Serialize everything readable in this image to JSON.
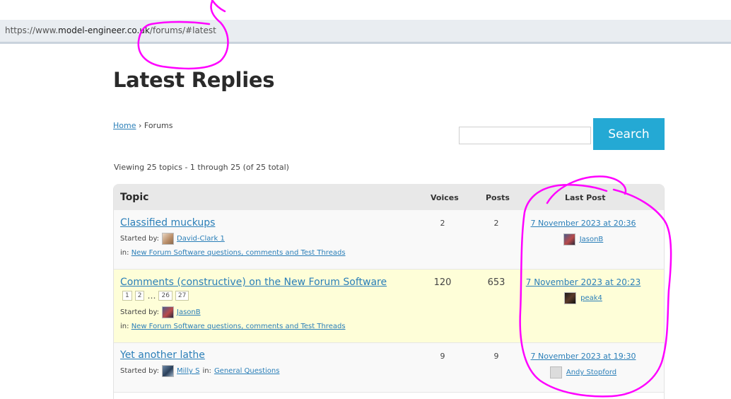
{
  "browser": {
    "url_prefix": "https://www.",
    "url_domain": "model-engineer.co.uk",
    "url_path": "/forums/#latest"
  },
  "page": {
    "title": "Latest Replies"
  },
  "breadcrumb": {
    "home": "Home",
    "separator": "›",
    "current": "Forums"
  },
  "search": {
    "button_label": "Search",
    "placeholder": ""
  },
  "viewing": "Viewing 25 topics - 1 through 25 (of 25 total)",
  "table": {
    "headers": {
      "topic": "Topic",
      "voices": "Voices",
      "posts": "Posts",
      "last_post": "Last Post"
    },
    "started_by_label": "Started by:",
    "in_label": "in:",
    "rows": [
      {
        "title": "Classified muckups",
        "author": "David-Clark 1",
        "forum": "New Forum Software questions, comments and Test Threads",
        "voices": "2",
        "posts": "2",
        "last_date": "7 November 2023 at 20:36",
        "last_author": "JasonB"
      },
      {
        "title": "Comments (constructive) on the New Forum Software",
        "pages": [
          "1",
          "2",
          "…",
          "26",
          "27"
        ],
        "author": "JasonB",
        "forum": "New Forum Software questions, comments and Test Threads",
        "voices": "120",
        "posts": "653",
        "last_date": "7 November 2023 at 20:23",
        "last_author": "peak4"
      },
      {
        "title": "Yet another lathe",
        "author": "Milly S",
        "forum": "General Questions",
        "voices": "9",
        "posts": "9",
        "last_date": "7 November 2023 at 19:30",
        "last_author": "Andy Stopford"
      }
    ]
  },
  "annotation_color": "#ff00ff"
}
